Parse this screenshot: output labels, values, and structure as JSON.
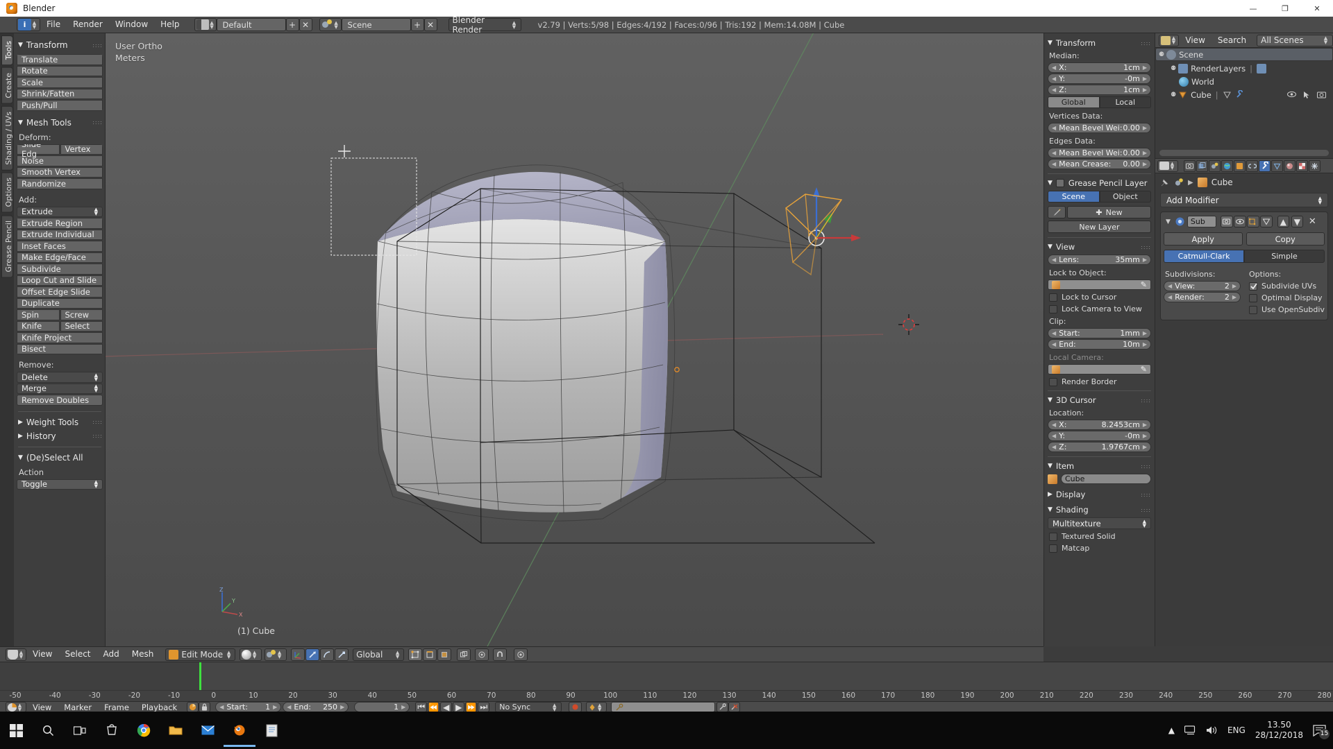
{
  "window": {
    "title": "Blender",
    "minimize": "—",
    "maximize": "❐",
    "close": "✕"
  },
  "info_header": {
    "menus": [
      "File",
      "Render",
      "Window",
      "Help"
    ],
    "screen_layout": "Default",
    "scene_name": "Scene",
    "render_engine": "Blender Render",
    "stats": "v2.79 | Verts:5/98 | Edges:4/192 | Faces:0/96 | Tris:192 | Mem:14.08M | Cube",
    "add_icon": "+",
    "close_icon": "✕"
  },
  "toolshelf": {
    "tabs": [
      "Tools",
      "Create",
      "Shading / UVs",
      "Options",
      "Grease Pencil"
    ],
    "active_tab": "Tools",
    "transform": {
      "title": "Transform",
      "buttons": [
        "Translate",
        "Rotate",
        "Scale",
        "Shrink/Fatten",
        "Push/Pull"
      ]
    },
    "mesh_tools": {
      "title": "Mesh Tools",
      "deform_label": "Deform:",
      "deform_pair": [
        "Slide Edg",
        "Vertex"
      ],
      "deform_rest": [
        "Noise",
        "Smooth Vertex",
        "Randomize"
      ],
      "add_label": "Add:",
      "add_dropdown": "Extrude",
      "add_buttons": [
        "Extrude Region",
        "Extrude Individual",
        "Inset Faces",
        "Make Edge/Face",
        "Subdivide",
        "Loop Cut and Slide",
        "Offset Edge Slide",
        "Duplicate"
      ],
      "add_pair1": [
        "Spin",
        "Screw"
      ],
      "add_pair2": [
        "Knife",
        "Select"
      ],
      "add_tail": [
        "Knife Project",
        "Bisect"
      ],
      "remove_label": "Remove:",
      "remove_dropdown1": "Delete",
      "remove_dropdown2": "Merge",
      "remove_button": "Remove Doubles"
    },
    "weight_tools_title": "Weight Tools",
    "history_title": "History",
    "deselect_title": "(De)Select All",
    "action_label": "Action",
    "action_value": "Toggle"
  },
  "viewport": {
    "view_name": "User Ortho",
    "unit_label": "Meters",
    "object_label": "(1) Cube",
    "axis_x": "X",
    "axis_y": "Y",
    "axis_z": "Z"
  },
  "viewport_header": {
    "menus": [
      "View",
      "Select",
      "Add",
      "Mesh"
    ],
    "mode": "Edit Mode",
    "transform_orientation": "Global",
    "pivot_icon": "pivot-icon",
    "snap_icon": "magnet-icon"
  },
  "npanel": {
    "transform": {
      "title": "Transform",
      "median_label": "Median:",
      "fields": [
        {
          "label": "X:",
          "value": "1cm"
        },
        {
          "label": "Y:",
          "value": "-0m"
        },
        {
          "label": "Z:",
          "value": "1cm"
        }
      ],
      "space": {
        "global": "Global",
        "local": "Local",
        "active": "Local"
      },
      "vertices_data_label": "Vertices Data:",
      "vertex_bevel": {
        "label": "Mean Bevel Wei:",
        "value": "0.00"
      },
      "edges_data_label": "Edges Data:",
      "edge_bevel": {
        "label": "Mean Bevel Wei:",
        "value": "0.00"
      },
      "edge_crease": {
        "label": "Mean Crease:",
        "value": "0.00"
      }
    },
    "grease_pencil": {
      "title": "Grease Pencil Layer",
      "checked": true,
      "source": {
        "scene": "Scene",
        "object": "Object",
        "active": "Scene"
      },
      "new_button": "New",
      "new_layer_button": "New Layer"
    },
    "view": {
      "title": "View",
      "lens": {
        "label": "Lens:",
        "value": "35mm"
      },
      "lock_to_object_label": "Lock to Object:",
      "lock_to_object_value": "",
      "lock_to_cursor": "Lock to Cursor",
      "lock_camera_to_view": "Lock Camera to View",
      "clip_label": "Clip:",
      "clip_start": {
        "label": "Start:",
        "value": "1mm"
      },
      "clip_end": {
        "label": "End:",
        "value": "10m"
      },
      "local_camera_label": "Local Camera:",
      "render_border": "Render Border"
    },
    "cursor": {
      "title": "3D Cursor",
      "location_label": "Location:",
      "fields": [
        {
          "label": "X:",
          "value": "8.2453cm"
        },
        {
          "label": "Y:",
          "value": "-0m"
        },
        {
          "label": "Z:",
          "value": "1.9767cm"
        }
      ]
    },
    "item": {
      "title": "Item",
      "name": "Cube"
    },
    "display": {
      "title": "Display"
    },
    "shading": {
      "title": "Shading",
      "method": "Multitexture",
      "textured_solid": "Textured Solid",
      "matcap": "Matcap"
    }
  },
  "outliner": {
    "menus": [
      "View",
      "Search"
    ],
    "display_mode": "All Scenes",
    "rows": [
      {
        "label": "Scene",
        "depth": 0,
        "icon": "scene-icon",
        "selected": true
      },
      {
        "label": "RenderLayers",
        "depth": 1,
        "icon": "renderlayers-icon",
        "selected": false
      },
      {
        "label": "World",
        "depth": 1,
        "icon": "world-icon",
        "selected": false
      },
      {
        "label": "Cube",
        "depth": 1,
        "icon": "mesh-icon",
        "selected": false
      }
    ]
  },
  "properties": {
    "breadcrumb": "Cube",
    "add_modifier": "Add Modifier",
    "modifier": {
      "name": "Sub",
      "apply": "Apply",
      "copy": "Copy",
      "type_catmull": "Catmull-Clark",
      "type_simple": "Simple",
      "active_type": "Catmull-Clark",
      "subdivisions_label": "Subdivisions:",
      "view": {
        "label": "View:",
        "value": "2"
      },
      "render": {
        "label": "Render:",
        "value": "2"
      },
      "options_label": "Options:",
      "subdivide_uvs": {
        "label": "Subdivide UVs",
        "checked": true
      },
      "optimal_display": {
        "label": "Optimal Display",
        "checked": false
      },
      "use_opensubdiv": {
        "label": "Use OpenSubdiv",
        "checked": false
      }
    }
  },
  "timeline": {
    "menus": [
      "View",
      "Marker",
      "Frame",
      "Playback"
    ],
    "start": {
      "label": "Start:",
      "value": "1"
    },
    "end": {
      "label": "End:",
      "value": "250"
    },
    "current_frame": "1",
    "sync_mode": "No Sync",
    "ruler_ticks": [
      "-50",
      "-40",
      "-30",
      "-20",
      "-10",
      "0",
      "10",
      "20",
      "30",
      "40",
      "50",
      "60",
      "70",
      "80",
      "90",
      "100",
      "110",
      "120",
      "130",
      "140",
      "150",
      "160",
      "170",
      "180",
      "190",
      "200",
      "210",
      "220",
      "230",
      "240",
      "250",
      "260",
      "270",
      "280"
    ]
  },
  "taskbar": {
    "language": "ENG",
    "time": "13.50",
    "date": "28/12/2018",
    "notification_count": "15"
  },
  "colors": {
    "accent_blue": "#4772b3",
    "header_gray": "#4b4b4b",
    "panel_gray": "#3e3e3e",
    "axis_x_red": "#c04a4a",
    "axis_y_green": "#4aa84a",
    "axis_z_blue": "#3b6fd4",
    "timeline_cursor": "#3ee03e"
  }
}
